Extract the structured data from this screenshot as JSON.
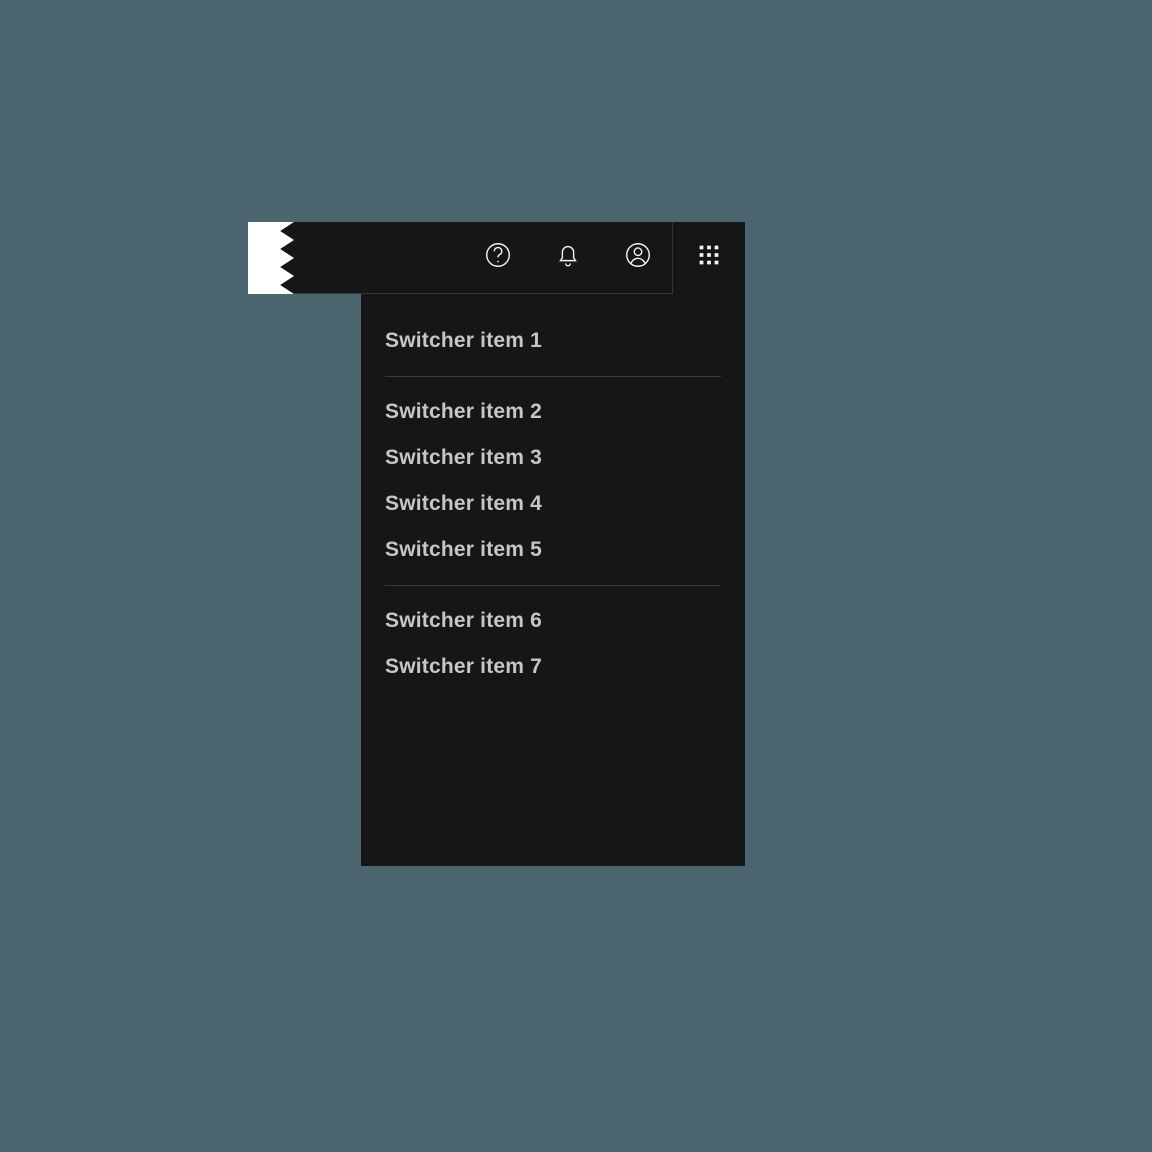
{
  "header": {
    "icons": {
      "help": "help-icon",
      "notifications": "bell-icon",
      "user": "user-icon",
      "switcher": "grid-icon"
    }
  },
  "switcher": {
    "groups": [
      {
        "items": [
          {
            "label": "Switcher item 1"
          }
        ]
      },
      {
        "items": [
          {
            "label": "Switcher item 2"
          },
          {
            "label": "Switcher item 3"
          },
          {
            "label": "Switcher item 4"
          },
          {
            "label": "Switcher item 5"
          }
        ]
      },
      {
        "items": [
          {
            "label": "Switcher item 6"
          },
          {
            "label": "Switcher item 7"
          }
        ]
      }
    ]
  }
}
